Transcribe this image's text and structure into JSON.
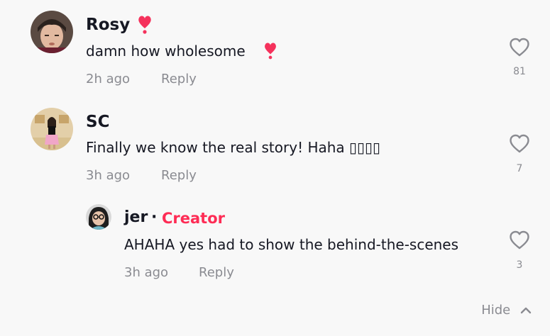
{
  "comments": [
    {
      "author": "Rosy",
      "text": "damn how wholesome",
      "time": "2h ago",
      "reply_label": "Reply",
      "likes": "81",
      "name_emoji": "heart-exclamation",
      "text_emoji": "heart-exclamation"
    },
    {
      "author": "SC",
      "text": "Finally we know the real story! Haha ▯▯▯▯",
      "time": "3h ago",
      "reply_label": "Reply",
      "likes": "7"
    }
  ],
  "reply": {
    "author": "jer",
    "separator": "·",
    "badge": "Creator",
    "text": "AHAHA yes had to show the behind-the-scenes",
    "time": "3h ago",
    "reply_label": "Reply",
    "likes": "3"
  },
  "hide_label": "Hide",
  "colors": {
    "accent": "#fe2c55",
    "text": "#161823",
    "muted": "#8a8b91",
    "background": "#f8f8f8"
  },
  "icons": {
    "like": "heart-outline-icon",
    "hide": "chevron-up-icon"
  }
}
